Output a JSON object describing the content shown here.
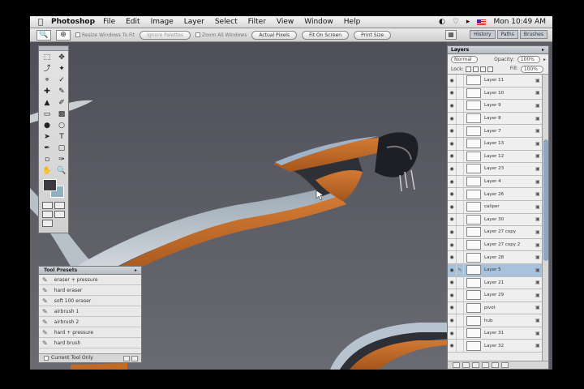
{
  "menubar": {
    "app": "Photoshop",
    "items": [
      "File",
      "Edit",
      "Image",
      "Layer",
      "Select",
      "Filter",
      "View",
      "Window",
      "Help"
    ],
    "clock": "Mon 10:49 AM"
  },
  "options": {
    "resize_windows": "Resize Windows To Fit",
    "ignore_palettes": "Ignore Palettes",
    "zoom_all": "Zoom All Windows",
    "actual_pixels": "Actual Pixels",
    "fit_on_screen": "Fit On Screen",
    "print_size": "Print Size",
    "well_tabs": [
      "History",
      "Paths",
      "Brushes"
    ]
  },
  "presets": {
    "title": "Tool Presets",
    "items": [
      "eraser + pressure",
      "hard eraser",
      "soft 100 eraser",
      "airbrush 1",
      "airbrush 2",
      "hard + pressure",
      "hard brush"
    ],
    "footer": "Current Tool Only"
  },
  "layers": {
    "title": "Layers",
    "blend_mode": "Normal",
    "opacity_label": "Opacity:",
    "opacity_value": "100%",
    "lock_label": "Lock:",
    "fill_label": "Fill:",
    "fill_value": "100%",
    "rows": [
      {
        "name": "Layer 11"
      },
      {
        "name": "Layer 10"
      },
      {
        "name": "Layer 9"
      },
      {
        "name": "Layer 8"
      },
      {
        "name": "Layer 7"
      },
      {
        "name": "Layer 13"
      },
      {
        "name": "Layer 12"
      },
      {
        "name": "Layer 23"
      },
      {
        "name": "Layer 4"
      },
      {
        "name": "Layer 26"
      },
      {
        "name": "caliper"
      },
      {
        "name": "Layer 30"
      },
      {
        "name": "Layer 27 copy"
      },
      {
        "name": "Layer 27 copy 2"
      },
      {
        "name": "Layer 28"
      },
      {
        "name": "Layer 5"
      },
      {
        "name": "Layer 21"
      },
      {
        "name": "Layer 29"
      },
      {
        "name": "pivot"
      },
      {
        "name": "hub"
      },
      {
        "name": "Layer 31"
      },
      {
        "name": "Layer 32"
      }
    ]
  }
}
